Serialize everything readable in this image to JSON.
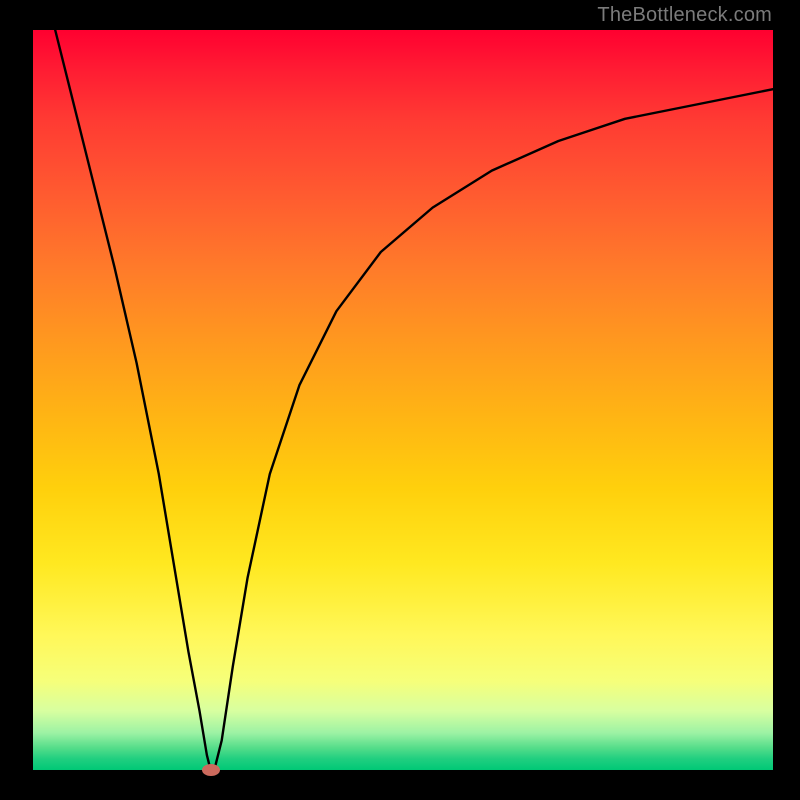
{
  "attribution": "TheBottleneck.com",
  "colors": {
    "frame": "#000000",
    "gradient_top": "#ff0030",
    "gradient_bottom": "#00c876",
    "curve": "#000000",
    "marker": "#cc6a5d",
    "attribution_text": "#7b7b7b"
  },
  "chart_data": {
    "type": "line",
    "title": "",
    "xlabel": "",
    "ylabel": "",
    "xlim": [
      0,
      100
    ],
    "ylim": [
      0,
      100
    ],
    "curve": [
      {
        "x": 3,
        "y": 100
      },
      {
        "x": 5,
        "y": 92
      },
      {
        "x": 8,
        "y": 80
      },
      {
        "x": 11,
        "y": 68
      },
      {
        "x": 14,
        "y": 55
      },
      {
        "x": 17,
        "y": 40
      },
      {
        "x": 19,
        "y": 28
      },
      {
        "x": 21,
        "y": 16
      },
      {
        "x": 22.5,
        "y": 8
      },
      {
        "x": 23.5,
        "y": 2
      },
      {
        "x": 24,
        "y": 0
      },
      {
        "x": 24.5,
        "y": 0
      },
      {
        "x": 25.5,
        "y": 4
      },
      {
        "x": 27,
        "y": 14
      },
      {
        "x": 29,
        "y": 26
      },
      {
        "x": 32,
        "y": 40
      },
      {
        "x": 36,
        "y": 52
      },
      {
        "x": 41,
        "y": 62
      },
      {
        "x": 47,
        "y": 70
      },
      {
        "x": 54,
        "y": 76
      },
      {
        "x": 62,
        "y": 81
      },
      {
        "x": 71,
        "y": 85
      },
      {
        "x": 80,
        "y": 88
      },
      {
        "x": 90,
        "y": 90
      },
      {
        "x": 100,
        "y": 92
      }
    ],
    "marker": {
      "x": 24,
      "y": 0
    },
    "grid": false,
    "legend": false
  }
}
